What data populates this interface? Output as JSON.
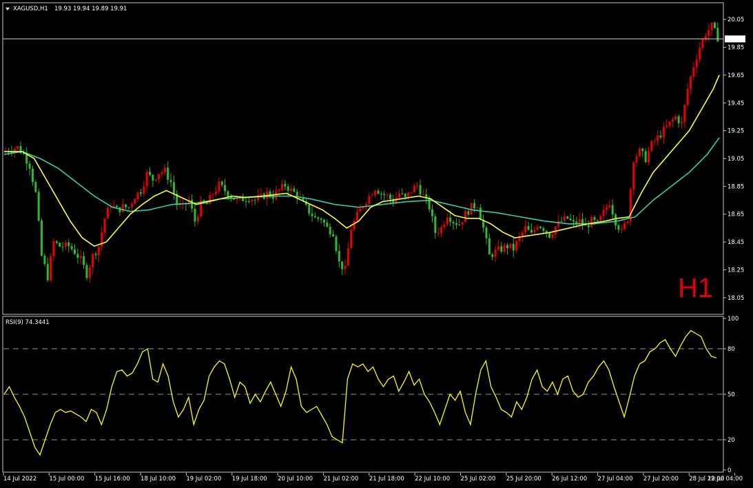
{
  "main_header": {
    "symbol": "XAGUSD,H1",
    "ohlc": "19.93 19.94 19.89 19.91"
  },
  "timeframe_label": "H1",
  "current_price_label": "19.91",
  "rsi_header": "RSI(9) 74.3441",
  "colors": {
    "background": "#000000",
    "bull": "#e60000",
    "bear": "#2db82d",
    "ma_fast": "#ffff33",
    "ma_slow": "#2fd4a6",
    "rsi": "#ffff00",
    "grid": "#c8c8c8",
    "timeframe": "#e00000"
  },
  "chart_data": [
    {
      "type": "candlestick",
      "title": "XAGUSD,H1",
      "ylim": [
        17.95,
        20.15
      ],
      "price_ticks": [
        "20.05",
        "19.85",
        "19.65",
        "19.45",
        "19.25",
        "19.05",
        "18.85",
        "18.65",
        "18.45",
        "18.25",
        "18.05"
      ],
      "x_ticks": [
        "14 Jul 2022",
        "15 Jul 00:00",
        "15 Jul 16:00",
        "18 Jul 10:00",
        "19 Jul 02:00",
        "19 Jul 18:00",
        "20 Jul 10:00",
        "21 Jul 02:00",
        "21 Jul 18:00",
        "22 Jul 10:00",
        "25 Jul 02:00",
        "25 Jul 20:00",
        "26 Jul 12:00",
        "27 Jul 04:00",
        "27 Jul 20:00",
        "28 Jul 12:00",
        "29 Jul 04:00"
      ],
      "current_price": 19.91,
      "close_path": [
        [
          0,
          19.1
        ],
        [
          3,
          19.12
        ],
        [
          5,
          19.13
        ],
        [
          7,
          19.08
        ],
        [
          9,
          19.0
        ],
        [
          11,
          18.8
        ],
        [
          13,
          18.35
        ],
        [
          15,
          18.2
        ],
        [
          17,
          18.45
        ],
        [
          19,
          18.42
        ],
        [
          22,
          18.42
        ],
        [
          24,
          18.38
        ],
        [
          26,
          18.32
        ],
        [
          28,
          18.22
        ],
        [
          30,
          18.35
        ],
        [
          32,
          18.42
        ],
        [
          34,
          18.62
        ],
        [
          36,
          18.72
        ],
        [
          38,
          18.68
        ],
        [
          40,
          18.7
        ],
        [
          42,
          18.7
        ],
        [
          44,
          18.78
        ],
        [
          46,
          18.82
        ],
        [
          48,
          18.94
        ],
        [
          50,
          18.9
        ],
        [
          52,
          18.95
        ],
        [
          54,
          18.96
        ],
        [
          56,
          18.88
        ],
        [
          58,
          18.72
        ],
        [
          60,
          18.7
        ],
        [
          62,
          18.75
        ],
        [
          64,
          18.6
        ],
        [
          66,
          18.72
        ],
        [
          68,
          18.72
        ],
        [
          70,
          18.8
        ],
        [
          72,
          18.86
        ],
        [
          74,
          18.82
        ],
        [
          76,
          18.78
        ],
        [
          78,
          18.75
        ],
        [
          80,
          18.76
        ],
        [
          82,
          18.77
        ],
        [
          84,
          18.75
        ],
        [
          86,
          18.77
        ],
        [
          88,
          18.8
        ],
        [
          90,
          18.78
        ],
        [
          92,
          18.82
        ],
        [
          94,
          18.86
        ],
        [
          96,
          18.82
        ],
        [
          98,
          18.79
        ],
        [
          100,
          18.72
        ],
        [
          102,
          18.67
        ],
        [
          104,
          18.62
        ],
        [
          106,
          18.62
        ],
        [
          108,
          18.55
        ],
        [
          110,
          18.52
        ],
        [
          112,
          18.3
        ],
        [
          114,
          18.25
        ],
        [
          116,
          18.55
        ],
        [
          118,
          18.64
        ],
        [
          120,
          18.72
        ],
        [
          122,
          18.78
        ],
        [
          124,
          18.84
        ],
        [
          126,
          18.8
        ],
        [
          128,
          18.78
        ],
        [
          130,
          18.74
        ],
        [
          132,
          18.8
        ],
        [
          134,
          18.76
        ],
        [
          136,
          18.82
        ],
        [
          138,
          18.86
        ],
        [
          140,
          18.78
        ],
        [
          142,
          18.7
        ],
        [
          144,
          18.52
        ],
        [
          146,
          18.55
        ],
        [
          148,
          18.65
        ],
        [
          150,
          18.6
        ],
        [
          152,
          18.58
        ],
        [
          154,
          18.65
        ],
        [
          156,
          18.7
        ],
        [
          158,
          18.72
        ],
        [
          160,
          18.55
        ],
        [
          162,
          18.35
        ],
        [
          164,
          18.38
        ],
        [
          166,
          18.4
        ],
        [
          168,
          18.42
        ],
        [
          170,
          18.4
        ],
        [
          172,
          18.48
        ],
        [
          174,
          18.55
        ],
        [
          176,
          18.5
        ],
        [
          178,
          18.58
        ],
        [
          180,
          18.55
        ],
        [
          182,
          18.5
        ],
        [
          184,
          18.56
        ],
        [
          186,
          18.6
        ],
        [
          188,
          18.62
        ],
        [
          190,
          18.58
        ],
        [
          192,
          18.6
        ],
        [
          194,
          18.56
        ],
        [
          196,
          18.6
        ],
        [
          198,
          18.58
        ],
        [
          200,
          18.66
        ],
        [
          202,
          18.74
        ],
        [
          204,
          18.6
        ],
        [
          206,
          18.52
        ],
        [
          208,
          18.62
        ],
        [
          210,
          19.05
        ],
        [
          212,
          19.1
        ],
        [
          214,
          19.05
        ],
        [
          216,
          19.15
        ],
        [
          218,
          19.2
        ],
        [
          220,
          19.25
        ],
        [
          222,
          19.3
        ],
        [
          224,
          19.35
        ],
        [
          226,
          19.3
        ],
        [
          228,
          19.55
        ],
        [
          230,
          19.72
        ],
        [
          232,
          19.85
        ],
        [
          234,
          19.95
        ],
        [
          236,
          20.0
        ],
        [
          238,
          19.92
        ]
      ],
      "ma_fast_path": [
        [
          0,
          19.1
        ],
        [
          6,
          19.1
        ],
        [
          10,
          19.05
        ],
        [
          14,
          18.9
        ],
        [
          18,
          18.75
        ],
        [
          22,
          18.6
        ],
        [
          26,
          18.48
        ],
        [
          30,
          18.42
        ],
        [
          34,
          18.45
        ],
        [
          38,
          18.55
        ],
        [
          42,
          18.65
        ],
        [
          46,
          18.72
        ],
        [
          50,
          18.78
        ],
        [
          54,
          18.82
        ],
        [
          56,
          18.8
        ],
        [
          60,
          18.76
        ],
        [
          64,
          18.72
        ],
        [
          70,
          18.75
        ],
        [
          76,
          18.78
        ],
        [
          80,
          18.77
        ],
        [
          86,
          18.78
        ],
        [
          90,
          18.79
        ],
        [
          94,
          18.8
        ],
        [
          100,
          18.74
        ],
        [
          106,
          18.68
        ],
        [
          110,
          18.62
        ],
        [
          114,
          18.55
        ],
        [
          118,
          18.6
        ],
        [
          122,
          18.7
        ],
        [
          126,
          18.74
        ],
        [
          132,
          18.76
        ],
        [
          138,
          18.78
        ],
        [
          142,
          18.76
        ],
        [
          146,
          18.7
        ],
        [
          150,
          18.64
        ],
        [
          154,
          18.62
        ],
        [
          158,
          18.62
        ],
        [
          162,
          18.58
        ],
        [
          166,
          18.52
        ],
        [
          170,
          18.48
        ],
        [
          176,
          18.5
        ],
        [
          182,
          18.52
        ],
        [
          188,
          18.55
        ],
        [
          194,
          18.58
        ],
        [
          200,
          18.6
        ],
        [
          204,
          18.62
        ],
        [
          208,
          18.63
        ],
        [
          212,
          18.8
        ],
        [
          216,
          18.95
        ],
        [
          220,
          19.05
        ],
        [
          224,
          19.15
        ],
        [
          228,
          19.25
        ],
        [
          232,
          19.4
        ],
        [
          236,
          19.55
        ],
        [
          238,
          19.65
        ]
      ],
      "ma_slow_path": [
        [
          0,
          19.08
        ],
        [
          6,
          19.1
        ],
        [
          12,
          19.05
        ],
        [
          18,
          18.98
        ],
        [
          24,
          18.88
        ],
        [
          30,
          18.78
        ],
        [
          36,
          18.7
        ],
        [
          42,
          18.67
        ],
        [
          48,
          18.68
        ],
        [
          56,
          18.72
        ],
        [
          64,
          18.73
        ],
        [
          72,
          18.76
        ],
        [
          80,
          18.77
        ],
        [
          90,
          18.78
        ],
        [
          96,
          18.78
        ],
        [
          102,
          18.76
        ],
        [
          110,
          18.72
        ],
        [
          118,
          18.7
        ],
        [
          126,
          18.72
        ],
        [
          134,
          18.74
        ],
        [
          142,
          18.75
        ],
        [
          148,
          18.72
        ],
        [
          156,
          18.68
        ],
        [
          164,
          18.66
        ],
        [
          172,
          18.63
        ],
        [
          180,
          18.6
        ],
        [
          188,
          18.58
        ],
        [
          196,
          18.58
        ],
        [
          204,
          18.6
        ],
        [
          210,
          18.63
        ],
        [
          216,
          18.75
        ],
        [
          222,
          18.85
        ],
        [
          228,
          18.95
        ],
        [
          234,
          19.08
        ],
        [
          238,
          19.2
        ]
      ],
      "bar_count": 238
    },
    {
      "type": "line",
      "title": "RSI(9) 74.3441",
      "ylim": [
        0,
        100
      ],
      "levels": [
        80,
        50,
        20
      ],
      "y_ticks": [
        "100",
        "80",
        "50",
        "20",
        "0"
      ],
      "values": [
        50,
        55,
        48,
        42,
        35,
        25,
        15,
        10,
        20,
        30,
        38,
        40,
        38,
        39,
        37,
        35,
        32,
        40,
        38,
        30,
        40,
        55,
        65,
        66,
        62,
        64,
        70,
        78,
        80,
        60,
        58,
        70,
        62,
        45,
        35,
        40,
        48,
        30,
        40,
        46,
        62,
        68,
        72,
        70,
        60,
        48,
        58,
        55,
        44,
        50,
        45,
        52,
        58,
        50,
        42,
        52,
        68,
        60,
        42,
        38,
        40,
        42,
        36,
        30,
        22,
        20,
        18,
        60,
        70,
        68,
        70,
        65,
        68,
        60,
        55,
        60,
        62,
        52,
        58,
        65,
        56,
        60,
        50,
        45,
        38,
        30,
        40,
        50,
        46,
        52,
        38,
        30,
        50,
        66,
        72,
        55,
        48,
        40,
        38,
        35,
        45,
        40,
        48,
        60,
        66,
        55,
        52,
        58,
        50,
        60,
        62,
        52,
        48,
        50,
        58,
        62,
        68,
        72,
        66,
        55,
        45,
        35,
        48,
        62,
        70,
        72,
        78,
        80,
        84,
        86,
        80,
        75,
        82,
        88,
        92,
        90,
        88,
        80,
        75,
        74
      ]
    }
  ]
}
